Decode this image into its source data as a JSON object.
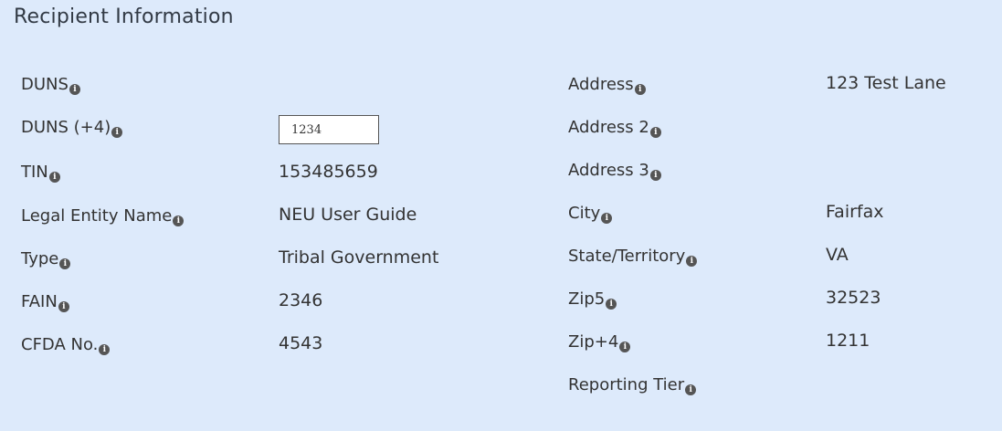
{
  "section": {
    "title": "Recipient Information"
  },
  "info_icon": {
    "glyph": "i",
    "icon_name": "info-icon",
    "color": "#555555"
  },
  "colors": {
    "background": "#ddeafb",
    "text": "#333333"
  },
  "left_fields": [
    {
      "label": "DUNS",
      "value": ""
    },
    {
      "label": "DUNS (+4)",
      "input_value": "1234"
    },
    {
      "label": "TIN",
      "value": "153485659"
    },
    {
      "label": "Legal Entity Name",
      "value": "NEU User Guide"
    },
    {
      "label": "Type",
      "value": "Tribal Government"
    },
    {
      "label": "FAIN",
      "value": "2346"
    },
    {
      "label": "CFDA No.",
      "value": "4543"
    }
  ],
  "right_fields": [
    {
      "label": "Address",
      "value": "123 Test Lane"
    },
    {
      "label": "Address 2",
      "value": ""
    },
    {
      "label": "Address 3",
      "value": ""
    },
    {
      "label": "City",
      "value": "Fairfax"
    },
    {
      "label": "State/Territory",
      "value": "VA"
    },
    {
      "label": "Zip5",
      "value": "32523"
    },
    {
      "label": "Zip+4",
      "value": "1211"
    },
    {
      "label": "Reporting Tier",
      "value": ""
    }
  ]
}
